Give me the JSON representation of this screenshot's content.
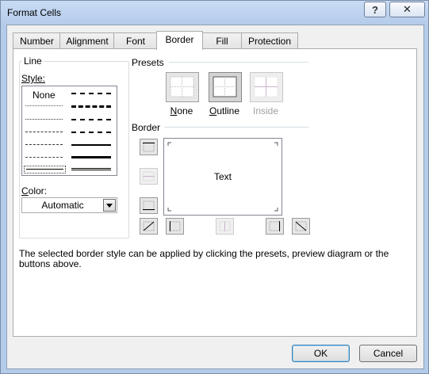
{
  "window": {
    "title": "Format Cells",
    "help_label": "?",
    "close_label": "✕"
  },
  "tabs": [
    {
      "label": "Number"
    },
    {
      "label": "Alignment"
    },
    {
      "label": "Font"
    },
    {
      "label": "Border",
      "active": true
    },
    {
      "label": "Fill"
    },
    {
      "label": "Protection"
    }
  ],
  "line": {
    "group_label": "Line",
    "style_label": "Style:",
    "none_label": "None",
    "color_label": "Color:",
    "color_value": "Automatic"
  },
  "presets": {
    "group_label": "Presets",
    "items": [
      {
        "label": "None"
      },
      {
        "label": "Outline"
      },
      {
        "label": "Inside"
      }
    ]
  },
  "border": {
    "group_label": "Border",
    "preview_text": "Text"
  },
  "description": "The selected border style can be applied by clicking the presets, preview diagram or the buttons above.",
  "buttons": {
    "ok": "OK",
    "cancel": "Cancel"
  },
  "colors": {
    "frame": "#b4cbea",
    "disabled_line": "#c9b4c9"
  }
}
